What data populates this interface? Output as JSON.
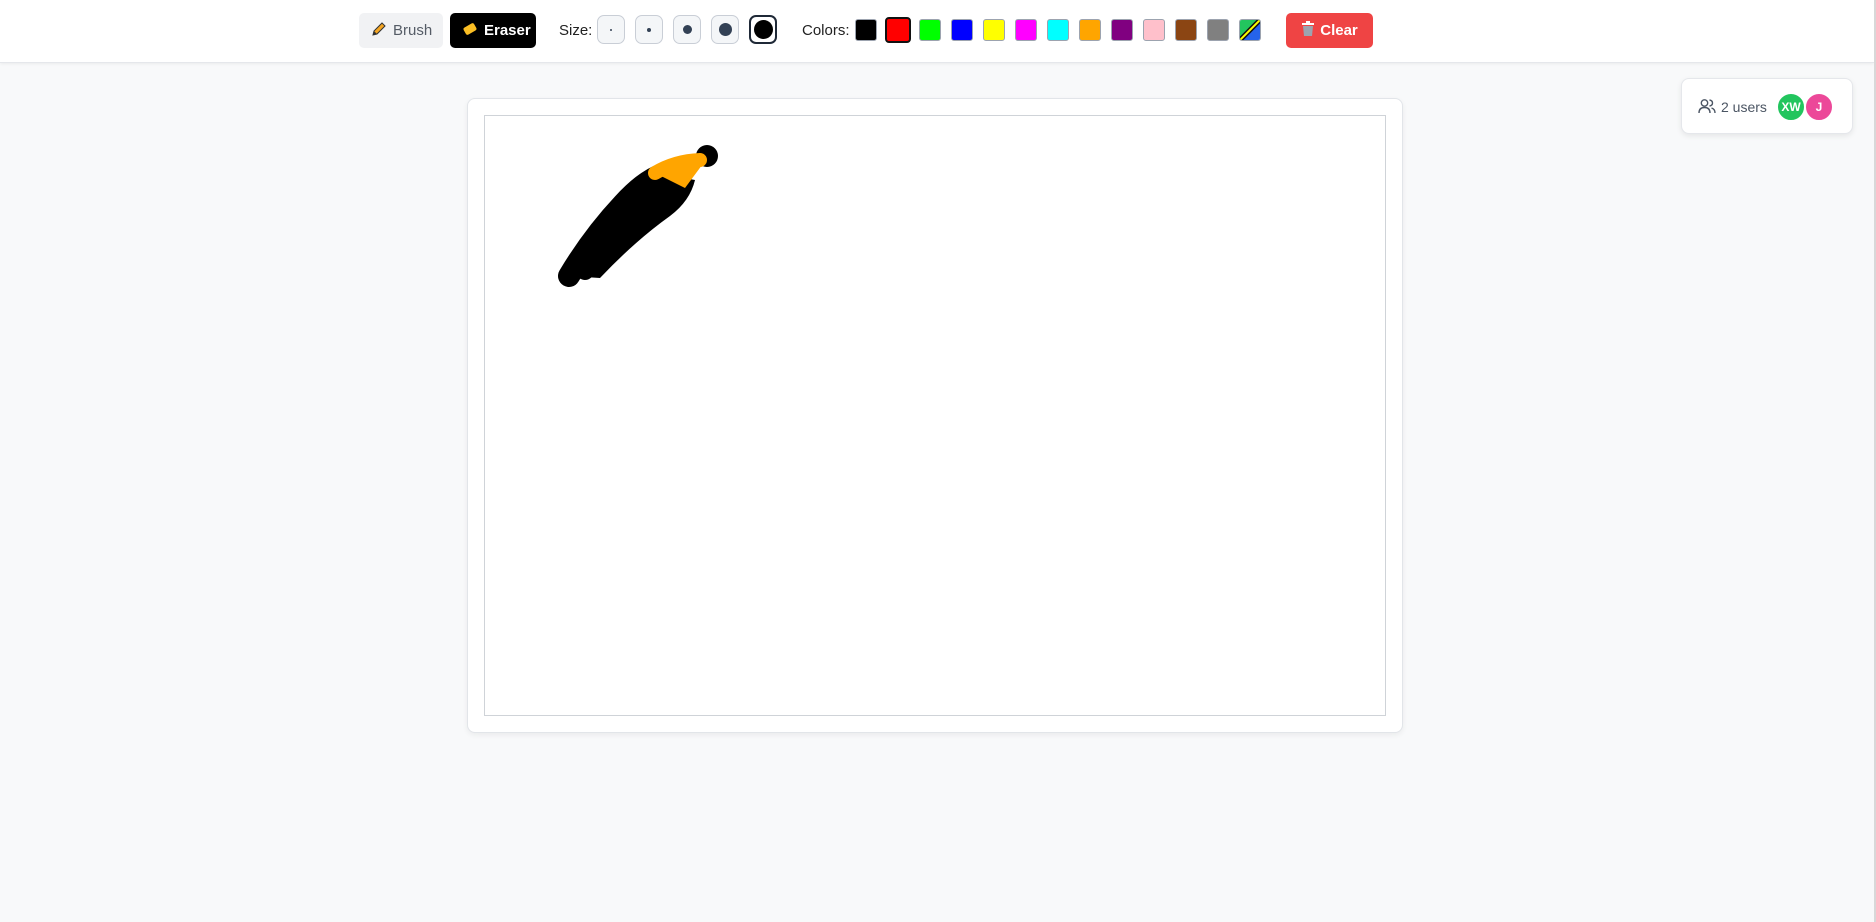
{
  "toolbar": {
    "brush_label": "Brush",
    "eraser_label": "Eraser",
    "active_tool": "eraser",
    "size_label": "Size:",
    "sizes": [
      2,
      4,
      8,
      12,
      18
    ],
    "active_size": 18,
    "colors_label": "Colors:",
    "colors": [
      "#000000",
      "#ff0000",
      "#00ff00",
      "#0000ff",
      "#ffff00",
      "#ff00ff",
      "#00ffff",
      "#ffa500",
      "#800080",
      "#ffc0cb",
      "#8b4513",
      "#808080"
    ],
    "active_color": "#ff0000",
    "clear_label": "Clear"
  },
  "icons": {
    "brush": "pencil-icon",
    "eraser": "eraser-icon",
    "clear": "trash-icon",
    "users": "users-icon",
    "custom_color": "color-picker-icon"
  },
  "users": {
    "count_label": "2 users",
    "list": [
      {
        "initials": "XW",
        "color": "#22c55e"
      },
      {
        "initials": "J",
        "color": "#ec4899"
      }
    ]
  },
  "theme": {
    "accent_dark": "#000000",
    "clear_red": "#ef4444",
    "stroke_orange": "#ffa500"
  }
}
